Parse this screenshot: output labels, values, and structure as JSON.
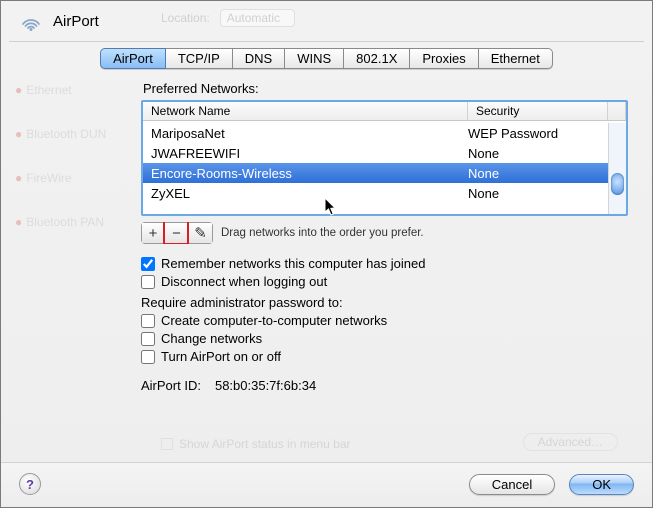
{
  "title": "AirPort",
  "location_label": "Location:",
  "location_value": "Automatic",
  "tabs": {
    "airport": "AirPort",
    "tcpip": "TCP/IP",
    "dns": "DNS",
    "wins": "WINS",
    "8021x": "802.1X",
    "proxies": "Proxies",
    "ethernet": "Ethernet"
  },
  "ghost_sidebar": [
    "Ethernet",
    "Bluetooth DUN",
    "FireWire",
    "Bluetooth PAN"
  ],
  "preferred_label": "Preferred Networks:",
  "columns": {
    "name": "Network Name",
    "security": "Security"
  },
  "networks": [
    {
      "name": "MariposaNet",
      "security": "WEP Password",
      "selected": false
    },
    {
      "name": "JWAFREEWIFI",
      "security": "None",
      "selected": false
    },
    {
      "name": "Encore-Rooms-Wireless",
      "security": "None",
      "selected": true
    },
    {
      "name": "ZyXEL",
      "security": "None",
      "selected": false
    }
  ],
  "drag_hint": "Drag networks into the order you prefer.",
  "checks": {
    "remember": {
      "label": "Remember networks this computer has joined",
      "checked": true
    },
    "disconnect": {
      "label": "Disconnect when logging out",
      "checked": false
    },
    "require_label": "Require administrator password to:",
    "create": {
      "label": "Create computer-to-computer networks",
      "checked": false
    },
    "change": {
      "label": "Change networks",
      "checked": false
    },
    "turn": {
      "label": "Turn AirPort on or off",
      "checked": false
    }
  },
  "airport_id_label": "AirPort ID:",
  "airport_id_value": "58:b0:35:7f:6b:34",
  "ghost_showstatus": "Show AirPort status in menu bar",
  "ghost_advanced": "Advanced…",
  "buttons": {
    "cancel": "Cancel",
    "ok": "OK"
  },
  "icons": {
    "plus": "+",
    "minus": "−",
    "pencil": "✎"
  }
}
